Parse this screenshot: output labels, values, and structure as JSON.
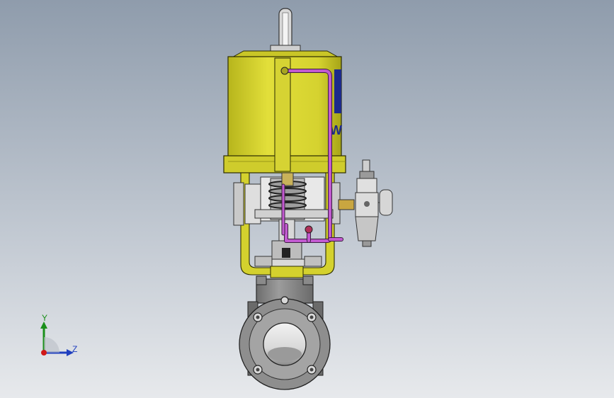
{
  "viewport": {
    "background_top": "#8f9cac",
    "background_bottom": "#e7e9ec"
  },
  "model": {
    "actuator_color": "#d9d92e",
    "tubing_color": "#c25ad0",
    "body_color": "#8a8a8a",
    "actuator_logo_text": "W"
  },
  "triad": {
    "y_label": "Y",
    "z_label": "Z",
    "y_color": "#1a8f1a",
    "z_color": "#1f3fbf",
    "x_color": "#d01818"
  }
}
